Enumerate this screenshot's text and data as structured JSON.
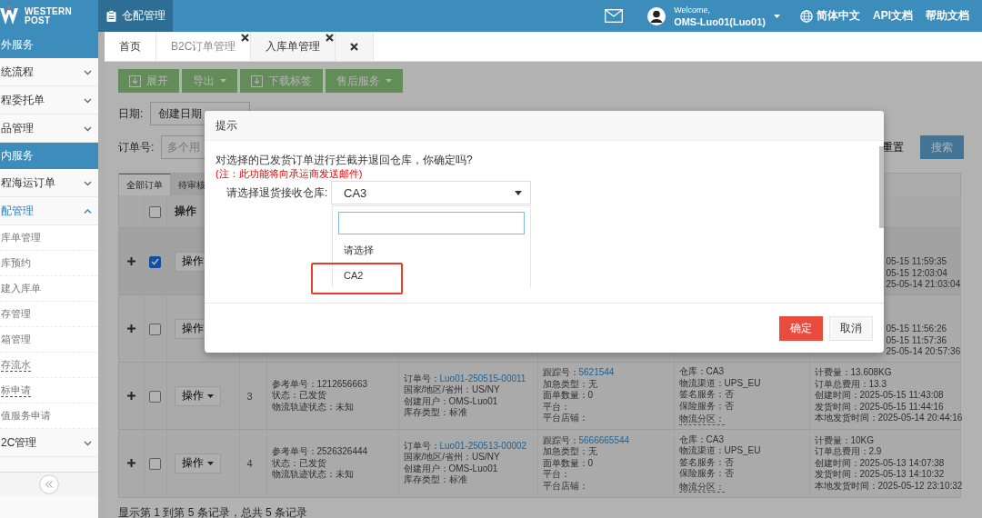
{
  "header": {
    "logo_line1": "WESTERN",
    "logo_line2": "POST",
    "nav": [
      {
        "label": "仓配管理",
        "selected": true
      }
    ],
    "welcome": "Welcome,",
    "user": "OMS-Luo01(Luo01)",
    "language": "简体中文",
    "links": [
      "API文档",
      "帮助文档"
    ]
  },
  "sidebar": {
    "items": [
      {
        "kind": "section",
        "label": "外服务"
      },
      {
        "kind": "menu",
        "label": "统流程",
        "expanded": false
      },
      {
        "kind": "menu",
        "label": "程委托单",
        "expanded": false
      },
      {
        "kind": "menu",
        "label": "品管理",
        "expanded": false
      },
      {
        "kind": "section",
        "label": "内服务"
      },
      {
        "kind": "menu",
        "label": "程海运订单",
        "expanded": false
      },
      {
        "kind": "menu",
        "label": "配管理",
        "expanded": true,
        "children": [
          {
            "label": "库单管理",
            "underlined": false
          },
          {
            "label": "库预约",
            "underlined": false
          },
          {
            "label": "建入库单",
            "underlined": false
          },
          {
            "label": "存管理",
            "underlined": false
          },
          {
            "label": "箱管理",
            "underlined": false
          },
          {
            "label": "存流水",
            "underlined": true
          },
          {
            "label": "标申请",
            "underlined": true
          },
          {
            "label": "值服务申请",
            "underlined": false
          }
        ]
      },
      {
        "kind": "menu",
        "label": "2C管理",
        "expanded": false
      }
    ]
  },
  "page_tabs": [
    {
      "kind": "page",
      "label": "首页",
      "closable": false,
      "selected": false
    },
    {
      "kind": "page",
      "label": "B2C订单管理",
      "closable": true,
      "selected": true
    },
    {
      "kind": "page",
      "label": "入库单管理",
      "closable": true,
      "selected": false
    },
    {
      "kind": "close-all"
    }
  ],
  "toolbar": [
    {
      "label": "展开",
      "kind": "icon"
    },
    {
      "label": "导出",
      "kind": "dropdown"
    },
    {
      "label": "下载标签",
      "kind": "icon"
    },
    {
      "label": "售后服务",
      "kind": "dropdown"
    }
  ],
  "filters": {
    "date_label": "日期:",
    "date_type": "创建日期",
    "order_label": "订单号:",
    "order_placeholder": "多个用",
    "reset": "重置",
    "search": "搜索"
  },
  "status_tabs": [
    {
      "label": "全部订单",
      "selected": true
    },
    {
      "label": "待审核",
      "selected": false
    }
  ],
  "table": {
    "op_header": "操作",
    "select_all_checked": false,
    "rows": [
      {
        "checked": true,
        "op": "操作",
        "fee_tail": [
          "05-15 11:59:35",
          "05-15 12:03:04",
          "25-05-14 21:03:04"
        ]
      },
      {
        "checked": false,
        "op": "操作",
        "fee_tail": [
          "05-15 11:56:26",
          "05-15 11:57:36",
          "25-05-14 20:57:36"
        ]
      },
      {
        "checked": false,
        "op": "操作",
        "index": "3",
        "reference": [
          {
            "label": "参考单号：",
            "value": "1212656663"
          },
          {
            "label": "状态：",
            "value": "已发货"
          },
          {
            "label": "物流轨迹状态：",
            "value": "未知"
          }
        ],
        "order": [
          {
            "label": "订单号：",
            "value": "Luo01-250515-00011",
            "link": true
          },
          {
            "label": "国家/地区/省州：",
            "value": "US/NY"
          },
          {
            "label": "创建用户：",
            "value": "OMS-Luo01"
          },
          {
            "label": "库存类型：",
            "value": "标准"
          }
        ],
        "tracking": [
          {
            "label": "跟踪号：",
            "value": "5621544",
            "link": true
          },
          {
            "label": "加急类型：",
            "value": "无"
          },
          {
            "label": "面单数量：",
            "value": "0"
          },
          {
            "label": "平台："
          },
          {
            "label": "平台店铺："
          }
        ],
        "warehouse": [
          {
            "label": "仓库：",
            "value": "CA3"
          },
          {
            "label": "物流渠道：",
            "value": "UPS_EU"
          },
          {
            "label": "签名服务：",
            "value": "否"
          },
          {
            "label": "保险服务：",
            "value": "否"
          },
          {
            "label": "物流分区：",
            "underlined": true
          }
        ],
        "fee": [
          {
            "label": "计费量：",
            "value": "13.608KG"
          },
          {
            "label": "订单总费用：",
            "value": "13.3"
          },
          {
            "label": "创建时间：",
            "value": "2025-05-15 11:43:08"
          },
          {
            "label": "发货时间：",
            "value": "2025-05-15 11:44:16"
          },
          {
            "label": "本地发货时间：",
            "value": "2025-05-14 20:44:16"
          }
        ]
      },
      {
        "checked": false,
        "op": "操作",
        "index": "4",
        "reference": [
          {
            "label": "参考单号：",
            "value": "2526326444"
          },
          {
            "label": "状态：",
            "value": "已发货"
          },
          {
            "label": "物流轨迹状态：",
            "value": "未知"
          }
        ],
        "order": [
          {
            "label": "订单号：",
            "value": "Luo01-250513-00002",
            "link": true
          },
          {
            "label": "国家/地区/省州：",
            "value": "US/NY"
          },
          {
            "label": "创建用户：",
            "value": "OMS-Luo01"
          },
          {
            "label": "库存类型：",
            "value": "标准"
          }
        ],
        "tracking": [
          {
            "label": "跟踪号：",
            "value": "5666665544",
            "link": true
          },
          {
            "label": "加急类型：",
            "value": "无"
          },
          {
            "label": "面单数量：",
            "value": "0"
          },
          {
            "label": "平台："
          },
          {
            "label": "平台店铺："
          }
        ],
        "warehouse": [
          {
            "label": "仓库：",
            "value": "CA3"
          },
          {
            "label": "物流渠道：",
            "value": "UPS_EU"
          },
          {
            "label": "签名服务：",
            "value": "否"
          },
          {
            "label": "保险服务：",
            "value": "否"
          },
          {
            "label": "物流分区：",
            "underlined": true
          }
        ],
        "fee": [
          {
            "label": "计费量：",
            "value": "10KG"
          },
          {
            "label": "订单总费用：",
            "value": "2.9"
          },
          {
            "label": "创建时间：",
            "value": "2025-05-13 14:07:38"
          },
          {
            "label": "发货时间：",
            "value": "2025-05-13 14:10:32"
          },
          {
            "label": "本地发货时间：",
            "value": "2025-05-12 23:10:32"
          }
        ]
      }
    ]
  },
  "footer": "显示第 1 到第 5 条记录，总共 5 条记录",
  "modal": {
    "title": "提示",
    "message": "对选择的已发货订单进行拦截并退回仓库，你确定吗?",
    "note": "(注：此功能将向承运商发送邮件)",
    "field_label": "请选择退货接收仓库:",
    "value": "CA3",
    "dropdown": {
      "open": true,
      "options": [
        {
          "label": "请选择",
          "highlighted": false
        },
        {
          "label": "CA2",
          "highlighted": true
        }
      ]
    },
    "buttons": [
      {
        "label": "确定",
        "kind": "primary"
      },
      {
        "label": "取消",
        "kind": "default"
      }
    ]
  }
}
